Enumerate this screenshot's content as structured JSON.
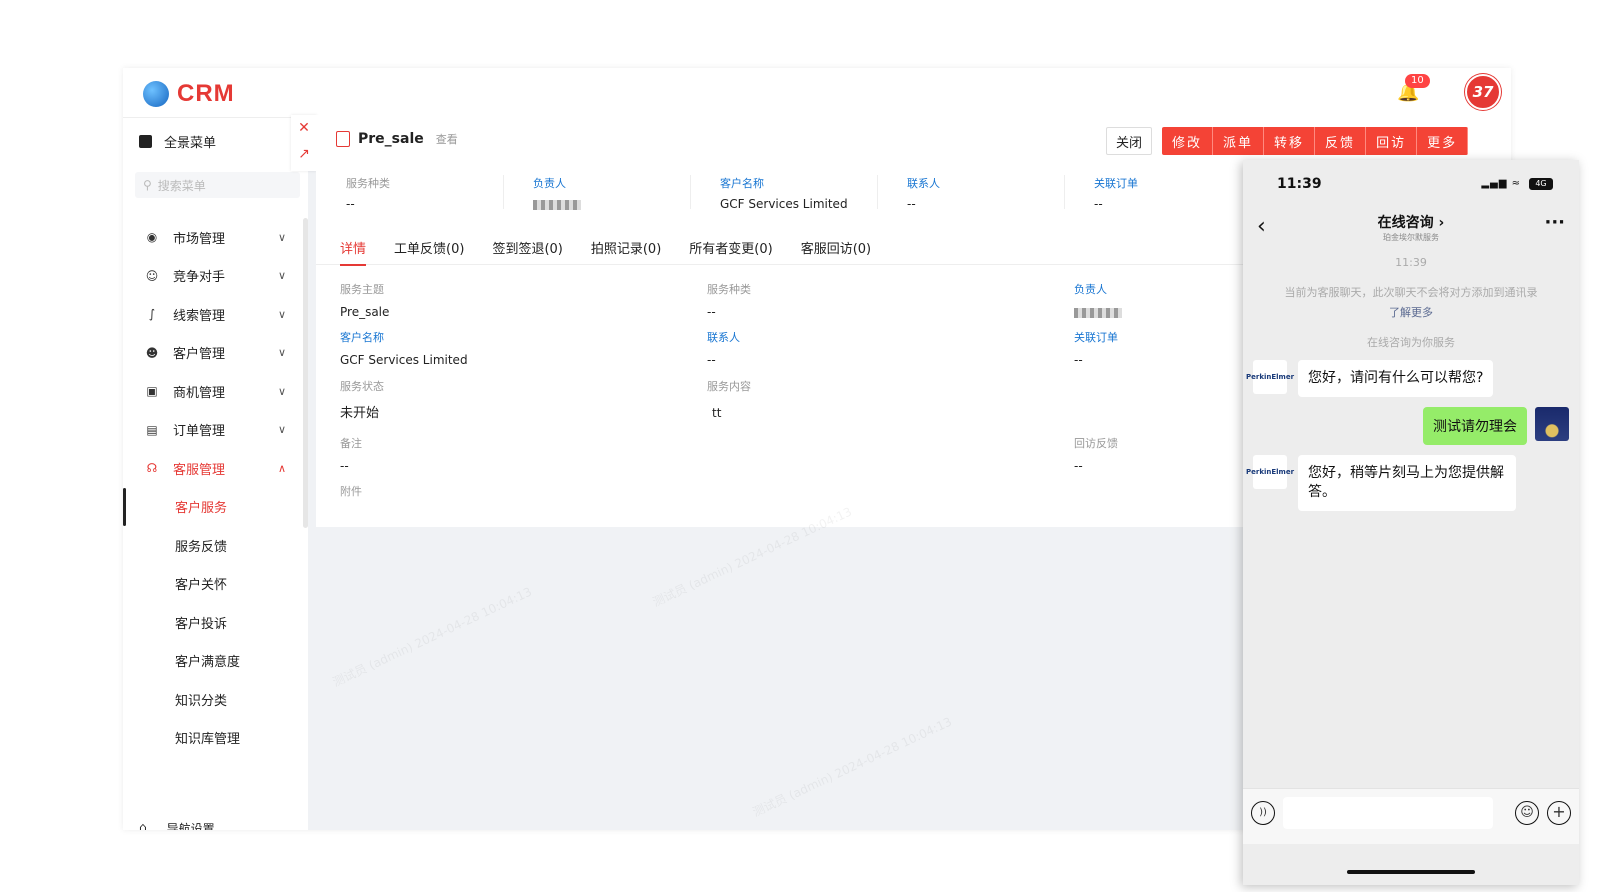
{
  "app": {
    "logo_text": "CRM",
    "notification_count": "10",
    "avatar_text": "37"
  },
  "sidebar": {
    "head_label": "全景菜单",
    "search_placeholder": "搜索菜单",
    "items": [
      {
        "label": "市场管理",
        "icon": "market-icon"
      },
      {
        "label": "竞争对手",
        "icon": "competitor-icon"
      },
      {
        "label": "线索管理",
        "icon": "lead-icon"
      },
      {
        "label": "客户管理",
        "icon": "customer-icon"
      },
      {
        "label": "商机管理",
        "icon": "opportunity-icon"
      },
      {
        "label": "订单管理",
        "icon": "order-icon"
      },
      {
        "label": "客服管理",
        "icon": "headset-icon"
      }
    ],
    "sub_items": [
      "客户服务",
      "服务反馈",
      "客户关怀",
      "客户投诉",
      "客户满意度",
      "知识分类",
      "知识库管理"
    ],
    "footer_label": "导航设置"
  },
  "main": {
    "title": "Pre_sale",
    "subtitle": "查看",
    "close_label": "关闭",
    "actions": [
      "修改",
      "派单",
      "转移",
      "反馈",
      "回访",
      "更多"
    ],
    "summary": [
      {
        "key": "服务种类",
        "value": "--",
        "link": false
      },
      {
        "key": "负责人",
        "value": "",
        "link": true
      },
      {
        "key": "客户名称",
        "value": "GCF Services Limited",
        "link": true
      },
      {
        "key": "联系人",
        "value": "--",
        "link": true
      },
      {
        "key": "关联订单",
        "value": "--",
        "link": true
      }
    ],
    "tabs": [
      "详情",
      "工单反馈(0)",
      "签到签退(0)",
      "拍照记录(0)",
      "所有者变更(0)",
      "客服回访(0)"
    ],
    "details": {
      "service_subject": {
        "key": "服务主题",
        "value": "Pre_sale"
      },
      "service_type": {
        "key": "服务种类",
        "value": "--"
      },
      "owner": {
        "key": "负责人",
        "value": ""
      },
      "customer_name": {
        "key": "客户名称",
        "value": "GCF Services Limited"
      },
      "contact": {
        "key": "联系人",
        "value": "--"
      },
      "related_order": {
        "key": "关联订单",
        "value": "--"
      },
      "service_status": {
        "key": "服务状态",
        "value": "未开始"
      },
      "service_content": {
        "key": "服务内容",
        "value": "tt"
      },
      "remark": {
        "key": "备注",
        "value": "--"
      },
      "visit_feedback": {
        "key": "回访反馈",
        "value": "--"
      },
      "attachment": {
        "key": "附件"
      }
    },
    "watermark": "测试员 (admin) 2024-04-28 10:04:13"
  },
  "phone": {
    "time": "11:39",
    "battery": "4G",
    "nav_title": "在线咨询 ›",
    "nav_sub": "珀金埃尔默服务",
    "chat_time": "11:39",
    "notice": "当前为客服聊天，此次聊天不会将对方添加到通讯录",
    "notice_link": "了解更多",
    "serving_note": "在线咨询为你服务",
    "bot_avatar_text": "PerkinElmer",
    "messages": [
      {
        "from": "bot",
        "text": "您好，请问有什么可以帮您?"
      },
      {
        "from": "me",
        "text": "测试请勿理会"
      },
      {
        "from": "bot",
        "text": "您好，稍等片刻马上为您提供解答。"
      }
    ]
  }
}
